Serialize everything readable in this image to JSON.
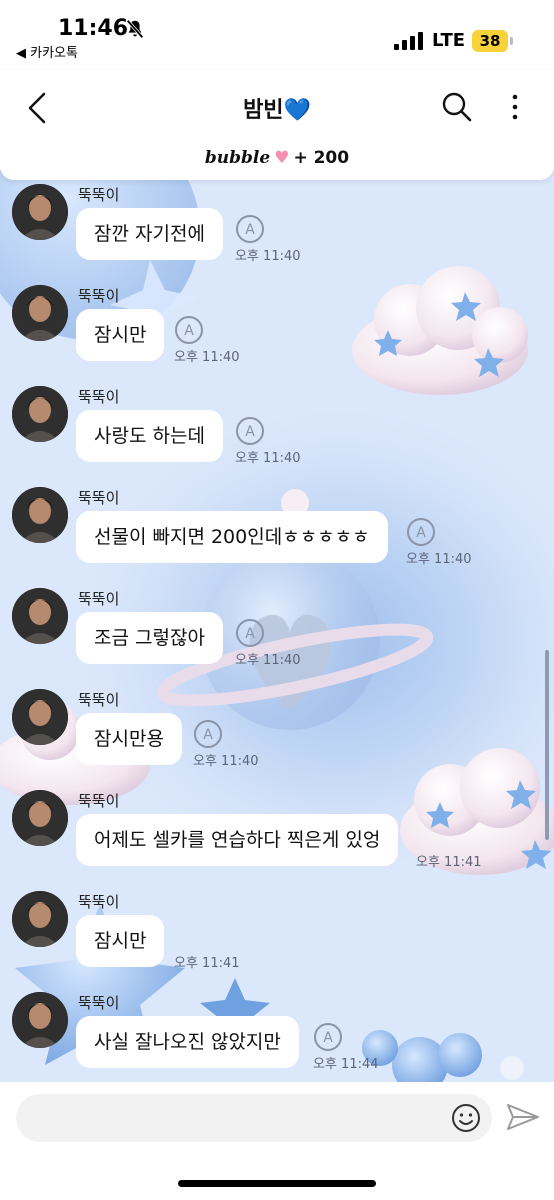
{
  "status_bar": {
    "time": "11:46",
    "back_app": "◀ 카카오톡",
    "network": "LTE",
    "battery": "38"
  },
  "header": {
    "title": "밤빈💙",
    "bubble_label": "bubble",
    "bubble_count": "+ 200"
  },
  "messages": [
    {
      "sender": "뚝뚝이",
      "text": "잠깐 자기전에",
      "time": "오후 11:40"
    },
    {
      "sender": "뚝뚝이",
      "text": "잠시만",
      "time": "오후 11:40"
    },
    {
      "sender": "뚝뚝이",
      "text": "사랑도 하는데",
      "time": "오후 11:40"
    },
    {
      "sender": "뚝뚝이",
      "text": "선물이 빠지면 200인데ㅎㅎㅎㅎㅎ",
      "time": "오후 11:40"
    },
    {
      "sender": "뚝뚝이",
      "text": "조금 그렇잖아",
      "time": "오후 11:40"
    },
    {
      "sender": "뚝뚝이",
      "text": "잠시만용",
      "time": "오후 11:40"
    },
    {
      "sender": "뚝뚝이",
      "text": "어제도 셀카를 연습하다 찍은게 있엉",
      "time": "오후 11:41"
    },
    {
      "sender": "뚝뚝이",
      "text": "잠시만",
      "time": "오후 11:41"
    },
    {
      "sender": "뚝뚝이",
      "text": "사실 잘나오진 않았지만",
      "time": "오후 11:44"
    }
  ],
  "colors": {
    "chat_background": "#d5e3f9",
    "battery": "#f7d23a",
    "bubble_heart": "#f48fb1"
  },
  "icons": [
    "bell-slash-icon",
    "signal-icon",
    "back-chevron-icon",
    "search-icon",
    "more-vertical-icon",
    "translate-a-icon",
    "emoji-icon",
    "send-icon"
  ]
}
